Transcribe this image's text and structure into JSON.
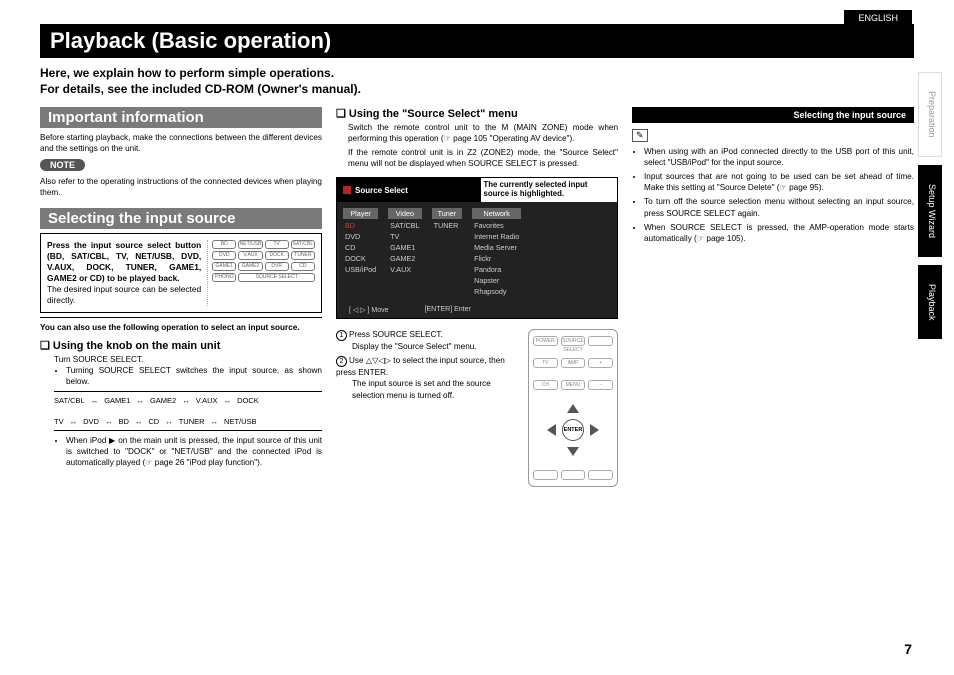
{
  "lang_tab": "ENGLISH",
  "side_tabs": [
    "Preparation",
    "Setup Wizard",
    "Playback"
  ],
  "title": "Playback (Basic operation)",
  "intro_l1": "Here, we explain how to perform simple operations.",
  "intro_l2": "For details, see the included CD-ROM (Owner's manual).",
  "black_strip": "Selecting the input source",
  "important": {
    "head": "Important information",
    "p1": "Before starting playback, make the connections between the different devices and the settings on the unit.",
    "note_label": "NOTE",
    "note_text": "Also refer to the operating instructions of the connected devices when playing them."
  },
  "select": {
    "head": "Selecting the input source",
    "box_line1": "Press the input source select button",
    "box_line2": "(BD, SAT/CBL, TV, NET/USB, DVD, V.AUX, DOCK, TUNER, GAME1, GAME2 or CD) to be played back.",
    "box_line3": "The desired input source can be selected directly.",
    "remote_buttons": [
      "BD",
      "NET/USB",
      "TV",
      "SAT/CBL",
      "DVD",
      "V.AUX",
      "DOCK",
      "TUNER",
      "GAME1",
      "GAME2",
      "DVR",
      "CD",
      "PHONO",
      "",
      "SOURCE SELECT",
      ""
    ],
    "also": "You can also use the following operation to select an input source.",
    "knob_head": "Using the knob on the main unit",
    "knob_turn": "Turn SOURCE SELECT.",
    "knob_switch": "Turning SOURCE SELECT switches the input source, as shown below.",
    "flow_row1": [
      "SAT/CBL",
      "GAME1",
      "GAME2",
      "V.AUX",
      "DOCK"
    ],
    "flow_row2": [
      "TV",
      "DVD",
      "BD",
      "CD",
      "TUNER",
      "NET/USB"
    ],
    "ipod_note": "When iPod ▶ on the main unit is pressed, the input source of this unit is switched to \"DOCK\" or \"NET/USB\" and the connected iPod is automatically played (☞ page 26 \"iPod play function\")."
  },
  "ssmenu": {
    "head": "Using the \"Source Select\" menu",
    "p1": "Switch the remote control unit to the M (MAIN ZONE) mode when performing this operation (☞ page 105 \"Operating AV device\").",
    "p2": "If the remote control unit is in Z2 (ZONE2) mode, the \"Source Select\" menu will not be displayed when SOURCE SELECT is pressed.",
    "menu_title": "Source Select",
    "menu_note": "The currently selected input source is highlighted.",
    "cats": [
      {
        "name": "Player",
        "items": [
          "BD",
          "DVD",
          "CD",
          "DOCK",
          "USB/iPod"
        ]
      },
      {
        "name": "Video",
        "items": [
          "SAT/CBL",
          "TV",
          "GAME1",
          "GAME2",
          "V.AUX"
        ]
      },
      {
        "name": "Tuner",
        "items": [
          "TUNER"
        ]
      },
      {
        "name": "Network",
        "items": [
          "Favorites",
          "Internet Radio",
          "Media Server",
          "Flickr",
          "Pandora",
          "Napster",
          "Rhapsody"
        ]
      }
    ],
    "foot_move": "[ ◁ ▷ ]  Move",
    "foot_enter": "[ENTER]  Enter",
    "step1a": "Press SOURCE SELECT.",
    "step1b": "Display the \"Source Select\" menu.",
    "step2a": "Use △▽◁▷ to select the input source, then press ENTER.",
    "step2b": "The input source is set and the source selection menu is turned off."
  },
  "right": {
    "pencil": "✎",
    "b1": "When using with an iPod connected directly to the USB port of this unit, select \"USB/iPod\" for the input source.",
    "b2": "Input sources that are not going to be used can be set ahead of time. Make this setting at \"Source Delete\" (☞ page 95).",
    "b3": "To turn off the source selection menu without selecting an input source, press SOURCE SELECT again.",
    "b4": "When SOURCE SELECT is pressed, the AMP-operation mode starts automatically (☞ page 105)."
  },
  "page_number": "7"
}
